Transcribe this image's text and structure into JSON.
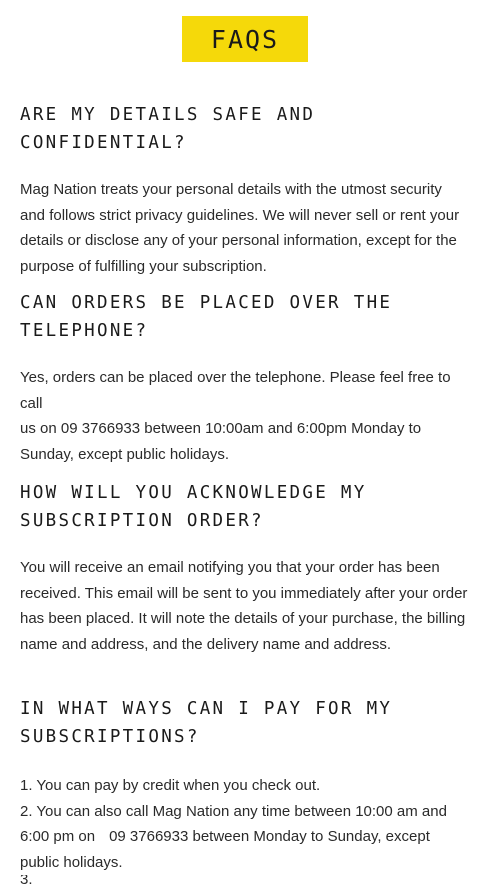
{
  "header": {
    "title": "FAQS"
  },
  "faqs": [
    {
      "question": "ARE MY DETAILS SAFE AND CONFIDENTIAL?",
      "answer_lines": [
        "Mag Nation treats your personal details with the utmost security",
        "and follows strict privacy guidelines. We will never sell or rent your",
        "details or disclose any of your personal information, except for the",
        "purpose of fulfilling your subscription."
      ]
    },
    {
      "question": "CAN ORDERS BE PLACED OVER THE TELEPHONE?",
      "answer_lines": [
        "Yes, orders can be placed over the telephone. Please feel free to call",
        "us on 09 3766933 between 10:00am and 6:00pm Monday to",
        "Sunday, except public holidays."
      ]
    },
    {
      "question": "HOW WILL YOU ACKNOWLEDGE MY SUBSCRIPTION ORDER?",
      "answer_lines": [
        "You will receive an email notifying you that your order has been",
        "received. This email will be sent to you immediately after your order",
        "has been placed. It will note the details of your purchase, the billing",
        "name and address, and the delivery name and address."
      ]
    },
    {
      "question": "IN WHAT WAYS CAN I PAY FOR MY SUBSCRIPTIONS?",
      "answer_lines": [
        "1. You can pay by credit when you check out.",
        "2. You can also call Mag Nation any time between 10:00 am and",
        "6:00 pm on",
        "09 3766933 between Monday to Sunday, except",
        "public holidays."
      ],
      "answer_tail": "3."
    }
  ],
  "colors": {
    "header_bg": "#f5d90a",
    "text": "#1a1a1a",
    "body_text": "#2a2a2a",
    "page_bg": "#ffffff"
  }
}
